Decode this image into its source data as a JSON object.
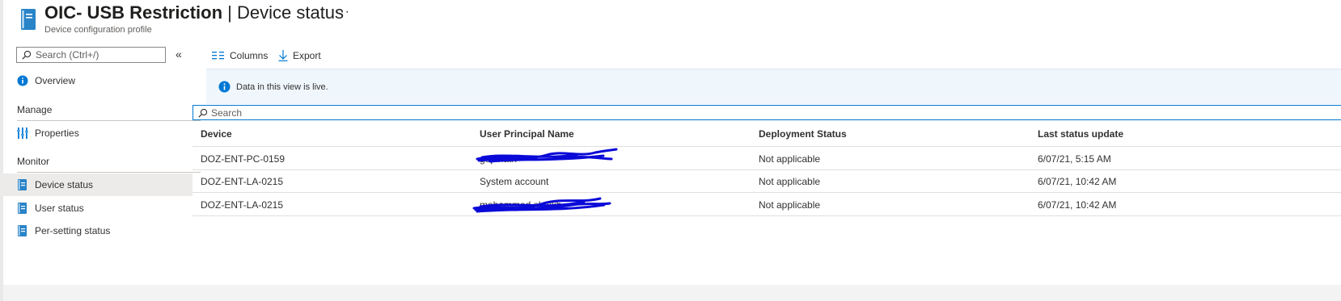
{
  "header": {
    "title_bold": "OIC- USB Restriction",
    "title_sep": " | ",
    "title_rest": "Device status",
    "more": "···",
    "subtitle": "Device configuration profile"
  },
  "nav": {
    "search_placeholder": "Search (Ctrl+/)",
    "collapse": "«",
    "overview": "Overview",
    "sections": [
      {
        "label": "Manage",
        "items": [
          {
            "label": "Properties",
            "icon": "properties-icon"
          }
        ]
      },
      {
        "label": "Monitor",
        "items": [
          {
            "label": "Device status",
            "icon": "profile-icon",
            "active": true
          },
          {
            "label": "User status",
            "icon": "profile-icon"
          },
          {
            "label": "Per-setting status",
            "icon": "profile-icon"
          }
        ]
      }
    ]
  },
  "toolbar": {
    "columns": "Columns",
    "export": "Export"
  },
  "info": {
    "text": "Data in this view is live."
  },
  "grid": {
    "search_placeholder": "Search",
    "columns": [
      "Device",
      "User Principal Name",
      "Deployment Status",
      "Last status update"
    ],
    "rows": [
      {
        "device": "DOZ-ENT-PC-0159",
        "upn": "gopinath",
        "upn_redacted": true,
        "status": "Not applicable",
        "updated": "6/07/21, 5:15 AM"
      },
      {
        "device": "DOZ-ENT-LA-0215",
        "upn": "System account",
        "upn_redacted": false,
        "status": "Not applicable",
        "updated": "6/07/21, 10:42 AM"
      },
      {
        "device": "DOZ-ENT-LA-0215",
        "upn": "mohammed.shaikh",
        "upn_redacted": true,
        "status": "Not applicable",
        "updated": "6/07/21, 10:42 AM"
      }
    ]
  },
  "colors": {
    "accent": "#0078d4",
    "redaction": "#0a0ad8",
    "banner": "#eff6fc"
  }
}
